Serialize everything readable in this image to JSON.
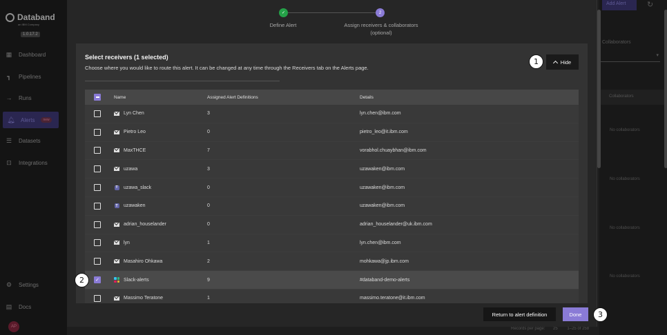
{
  "app": {
    "brand": "Databand",
    "brand_sub": "an IBM Company",
    "version": "1.0.17.2",
    "nav": [
      {
        "label": "Dashboard",
        "icon": "dashboard-icon"
      },
      {
        "label": "Pipelines",
        "icon": "pipelines-icon"
      },
      {
        "label": "Runs",
        "icon": "runs-icon"
      },
      {
        "label": "Alerts",
        "icon": "bell-icon",
        "badge": "new"
      },
      {
        "label": "Datasets",
        "icon": "database-icon"
      },
      {
        "label": "Integrations",
        "icon": "integrations-icon"
      }
    ],
    "settings": "Settings",
    "docs": "Docs",
    "avatar": "AP",
    "add_alert": "Add Alert",
    "collaborators_label": "Collaborators",
    "collaborators_col": "Collaborators",
    "no_collaborators": "No collaborators",
    "footer_records": "Records per page:",
    "footer_per_page": "25",
    "footer_range": "1–25 of 258"
  },
  "stepper": {
    "step1_label": "Define Alert",
    "step2_number": "2",
    "step2_label": "Assign receivers & collaborators",
    "step2_sub": "(optional)"
  },
  "panel": {
    "title": "Select receivers (1 selected)",
    "description": "Choose where you would like to route this alert. It can be changed at any time through the Receivers tab on the Alerts page.",
    "hide_label": "Hide"
  },
  "table": {
    "columns": [
      "Name",
      "Assigned Alert Definitions",
      "Details"
    ],
    "rows": [
      {
        "type": "email",
        "name": "Lyn Chen",
        "count": "3",
        "details": "lyn.chen@ibm.com",
        "checked": false
      },
      {
        "type": "email",
        "name": "Pietro Leo",
        "count": "0",
        "details": "pietro_leo@it.ibm.com",
        "checked": false
      },
      {
        "type": "email",
        "name": "MaxTHCE",
        "count": "7",
        "details": "vorabhol.chuaybhan@ibm.com",
        "checked": false
      },
      {
        "type": "email",
        "name": "uzawa",
        "count": "3",
        "details": "uzawaken@ibm.com",
        "checked": false
      },
      {
        "type": "teams",
        "name": "uzawa_slack",
        "count": "0",
        "details": "uzawaken@ibm.com",
        "checked": false
      },
      {
        "type": "teams",
        "name": "uzawaken",
        "count": "0",
        "details": "uzawaken@ibm.com",
        "checked": false
      },
      {
        "type": "email",
        "name": "adrian_houselander",
        "count": "0",
        "details": "adrian_houselander@uk.ibm.com",
        "checked": false
      },
      {
        "type": "email",
        "name": "lyn",
        "count": "1",
        "details": "lyn.chen@ibm.com",
        "checked": false
      },
      {
        "type": "email",
        "name": "Masahiro Ohkawa",
        "count": "2",
        "details": "mohkawa@jp.ibm.com",
        "checked": false
      },
      {
        "type": "slack",
        "name": "Slack-alerts",
        "count": "9",
        "details": "#databand-demo-alerts",
        "checked": true
      },
      {
        "type": "email",
        "name": "Massimo Teratone",
        "count": "1",
        "details": "massimo.teratone@it.ibm.com",
        "checked": false
      }
    ]
  },
  "footer": {
    "return_label": "Return to alert definition",
    "done_label": "Done"
  },
  "callouts": [
    "1",
    "2",
    "3"
  ],
  "colors": {
    "accent": "#8a7bd6",
    "success": "#24a148"
  }
}
